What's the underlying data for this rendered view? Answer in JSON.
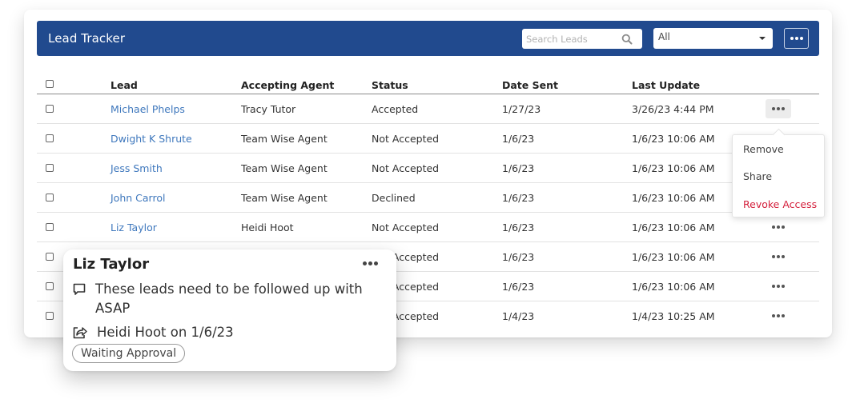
{
  "header": {
    "title": "Lead Tracker",
    "search_placeholder": "Search Leads",
    "search_value": "",
    "filter_selected": "All",
    "more_label": "More actions"
  },
  "table": {
    "columns": [
      "",
      "Lead",
      "Accepting Agent",
      "Status",
      "Date Sent",
      "Last Update",
      ""
    ],
    "rows": [
      {
        "lead": "Michael Phelps",
        "agent": "Tracy Tutor",
        "status": "Accepted",
        "date_sent": "1/27/23",
        "last_update": "3/26/23 4:44 PM"
      },
      {
        "lead": "Dwight K Shrute",
        "agent": "Team Wise Agent",
        "status": "Not Accepted",
        "date_sent": "1/6/23",
        "last_update": "1/6/23 10:06 AM"
      },
      {
        "lead": "Jess Smith",
        "agent": "Team Wise Agent",
        "status": "Not Accepted",
        "date_sent": "1/6/23",
        "last_update": "1/6/23 10:06 AM"
      },
      {
        "lead": "John Carrol",
        "agent": "Team Wise Agent",
        "status": "Declined",
        "date_sent": "1/6/23",
        "last_update": "1/6/23 10:06 AM"
      },
      {
        "lead": "Liz Taylor",
        "agent": "Heidi Hoot",
        "status": "Not Accepted",
        "date_sent": "1/6/23",
        "last_update": "1/6/23 10:06 AM"
      },
      {
        "lead": "",
        "agent": "",
        "status": "Not Accepted",
        "date_sent": "1/6/23",
        "last_update": "1/6/23 10:06 AM"
      },
      {
        "lead": "",
        "agent": "",
        "status": "Not Accepted",
        "date_sent": "1/6/23",
        "last_update": "1/6/23 10:06 AM"
      },
      {
        "lead": "",
        "agent": "",
        "status": "Not Accepted",
        "date_sent": "1/4/23",
        "last_update": "1/4/23 10:25 AM"
      }
    ]
  },
  "row_menu": {
    "items": [
      {
        "label": "Remove"
      },
      {
        "label": "Share"
      },
      {
        "label": "Revoke Access",
        "danger": true
      }
    ]
  },
  "popover": {
    "name": "Liz Taylor",
    "note": "These leads need to be followed up with ASAP",
    "shared_by": "Heidi Hoot on 1/6/23",
    "badge": "Waiting Approval"
  },
  "colors": {
    "header_bg": "#214a8e",
    "link": "#3f78bd",
    "danger": "#d4213d"
  },
  "icons": {
    "search": "search-icon",
    "caret": "caret-down-icon",
    "more": "more-horizontal-icon",
    "note": "comment-icon",
    "share": "share-icon"
  }
}
